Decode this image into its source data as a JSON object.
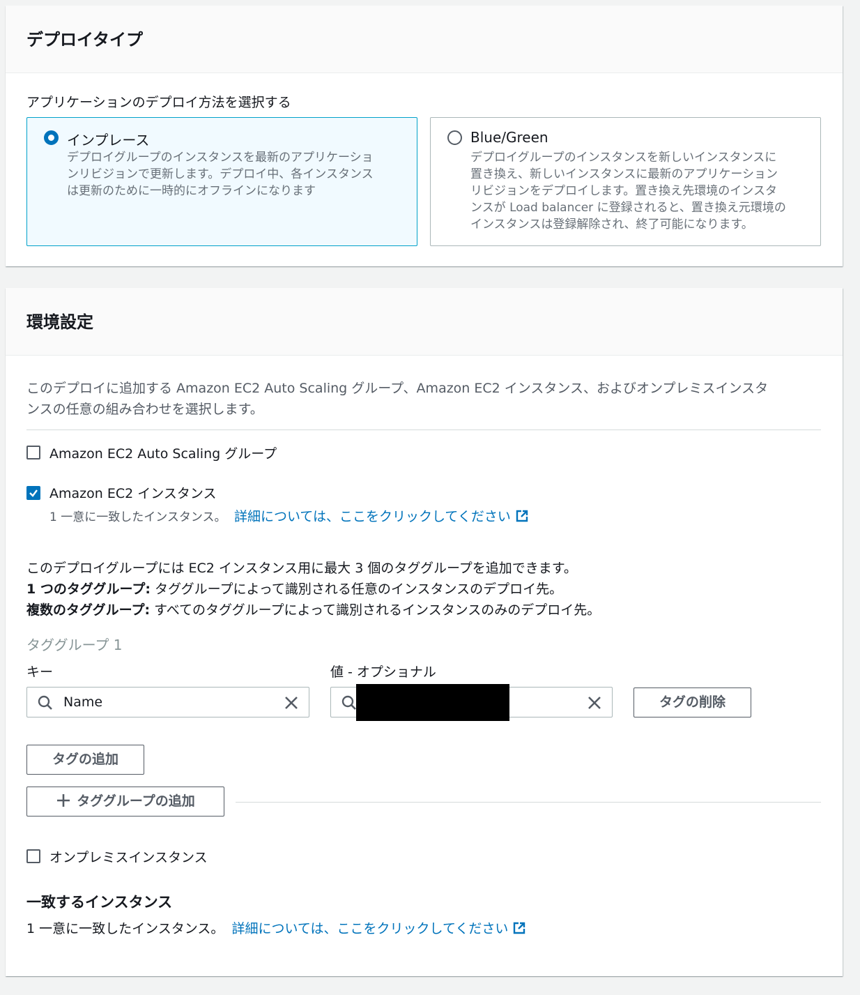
{
  "deploy_type": {
    "title": "デプロイタイプ",
    "subtitle": "アプリケーションのデプロイ方法を選択する",
    "options": [
      {
        "label": "インプレース",
        "description": [
          "デプロイグループのインスタンスを最新のアプリケーショ",
          "ンリビジョンで更新します。デプロイ中、各インスタンス",
          "は更新のために一時的にオフラインになります"
        ],
        "selected": true
      },
      {
        "label": "Blue/Green",
        "description": [
          "デプロイグループのインスタンスを新しいインスタンスに",
          "置き換え、新しいインスタンスに最新のアプリケーション",
          "リビジョンをデプロイします。置き換え先環境のインスタ",
          "ンスが Load balancer に登録されると、置き換え元環境の",
          "インスタンスは登録解除され、終了可能になります。"
        ],
        "selected": false
      }
    ]
  },
  "env": {
    "title": "環境設定",
    "description": [
      "このデプロイに追加する Amazon EC2 Auto Scaling グループ、Amazon EC2 インスタンス、およびオンプレミスインスタ",
      "ンスの任意の組み合わせを選択します。"
    ],
    "asg_label": "Amazon EC2 Auto Scaling グループ",
    "asg_checked": false,
    "ec2_label": "Amazon EC2 インスタンス",
    "ec2_checked": true,
    "ec2_match_text": "1 一意に一致したインスタンス。",
    "ec2_link": "詳細については、ここをクリックしてください",
    "tag_info": {
      "line1": "このデプロイグループには EC2 インスタンス用に最大 3 個のタググループを追加できます。",
      "line2_bold": "1 つのタググループ:",
      "line2_rest": " タググループによって識別される任意のインスタンスのデプロイ先。",
      "line3_bold": "複数のタググループ:",
      "line3_rest": " すべてのタググループによって識別されるインスタンスのみのデプロイ先。"
    },
    "tag_group": {
      "title": "タググループ 1",
      "key_label": "キー",
      "value_label": "値 - オプショナル",
      "key_value": "Name",
      "value_value": "",
      "remove_tag_button": "タグの削除",
      "add_tag_button": "タグの追加"
    },
    "add_tag_group_button": "タググループの追加",
    "onprem_label": "オンプレミスインスタンス",
    "onprem_checked": false,
    "matching": {
      "title": "一致するインスタンス",
      "text": "1 一意に一致したインスタンス。",
      "link": "詳細については、ここをクリックしてください"
    }
  }
}
